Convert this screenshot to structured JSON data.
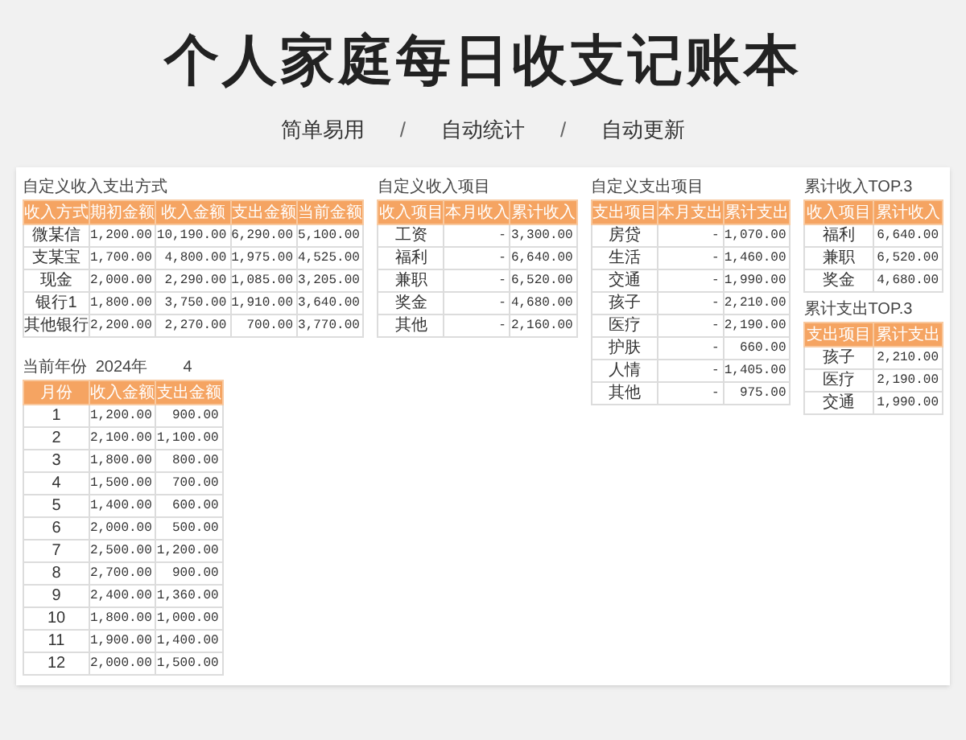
{
  "title": "个人家庭每日收支记账本",
  "taglines": [
    "简单易用",
    "自动统计",
    "自动更新"
  ],
  "separators": [
    "/",
    "/"
  ],
  "payment_methods": {
    "caption": "自定义收入支出方式",
    "columns": [
      "收入方式",
      "期初金额",
      "收入金额",
      "支出金额",
      "当前金额"
    ],
    "rows": [
      [
        "微某信",
        "1,200.00",
        "10,190.00",
        "6,290.00",
        "5,100.00"
      ],
      [
        "支某宝",
        "1,700.00",
        "4,800.00",
        "1,975.00",
        "4,525.00"
      ],
      [
        "现金",
        "2,000.00",
        "2,290.00",
        "1,085.00",
        "3,205.00"
      ],
      [
        "银行1",
        "1,800.00",
        "3,750.00",
        "1,910.00",
        "3,640.00"
      ],
      [
        "其他银行",
        "2,200.00",
        "2,270.00",
        "700.00",
        "3,770.00"
      ]
    ]
  },
  "income_items": {
    "caption": "自定义收入项目",
    "columns": [
      "收入项目",
      "本月收入",
      "累计收入"
    ],
    "rows": [
      [
        "工资",
        "-",
        "3,300.00"
      ],
      [
        "福利",
        "-",
        "6,640.00"
      ],
      [
        "兼职",
        "-",
        "6,520.00"
      ],
      [
        "奖金",
        "-",
        "4,680.00"
      ],
      [
        "其他",
        "-",
        "2,160.00"
      ]
    ]
  },
  "expense_items": {
    "caption": "自定义支出项目",
    "columns": [
      "支出项目",
      "本月支出",
      "累计支出"
    ],
    "rows": [
      [
        "房贷",
        "-",
        "1,070.00"
      ],
      [
        "生活",
        "-",
        "1,460.00"
      ],
      [
        "交通",
        "-",
        "1,990.00"
      ],
      [
        "孩子",
        "-",
        "2,210.00"
      ],
      [
        "医疗",
        "-",
        "2,190.00"
      ],
      [
        "护肤",
        "-",
        "660.00"
      ],
      [
        "人情",
        "-",
        "1,405.00"
      ],
      [
        "其他",
        "-",
        "975.00"
      ]
    ]
  },
  "top_income": {
    "caption": "累计收入TOP.3",
    "columns": [
      "收入项目",
      "累计收入"
    ],
    "rows": [
      [
        "福利",
        "6,640.00"
      ],
      [
        "兼职",
        "6,520.00"
      ],
      [
        "奖金",
        "4,680.00"
      ]
    ]
  },
  "top_expense": {
    "caption": "累计支出TOP.3",
    "columns": [
      "支出项目",
      "累计支出"
    ],
    "rows": [
      [
        "孩子",
        "2,210.00"
      ],
      [
        "医疗",
        "2,190.00"
      ],
      [
        "交通",
        "1,990.00"
      ]
    ]
  },
  "current_year": {
    "label": "当前年份",
    "year": "2024年",
    "month": "4"
  },
  "monthly": {
    "columns": [
      "月份",
      "收入金额",
      "支出金额"
    ],
    "rows": [
      [
        "1",
        "1,200.00",
        "900.00"
      ],
      [
        "2",
        "2,100.00",
        "1,100.00"
      ],
      [
        "3",
        "1,800.00",
        "800.00"
      ],
      [
        "4",
        "1,500.00",
        "700.00"
      ],
      [
        "5",
        "1,400.00",
        "600.00"
      ],
      [
        "6",
        "2,000.00",
        "500.00"
      ],
      [
        "7",
        "2,500.00",
        "1,200.00"
      ],
      [
        "8",
        "2,700.00",
        "900.00"
      ],
      [
        "9",
        "2,400.00",
        "1,360.00"
      ],
      [
        "10",
        "1,800.00",
        "1,000.00"
      ],
      [
        "11",
        "1,900.00",
        "1,400.00"
      ],
      [
        "12",
        "2,000.00",
        "1,500.00"
      ]
    ]
  }
}
